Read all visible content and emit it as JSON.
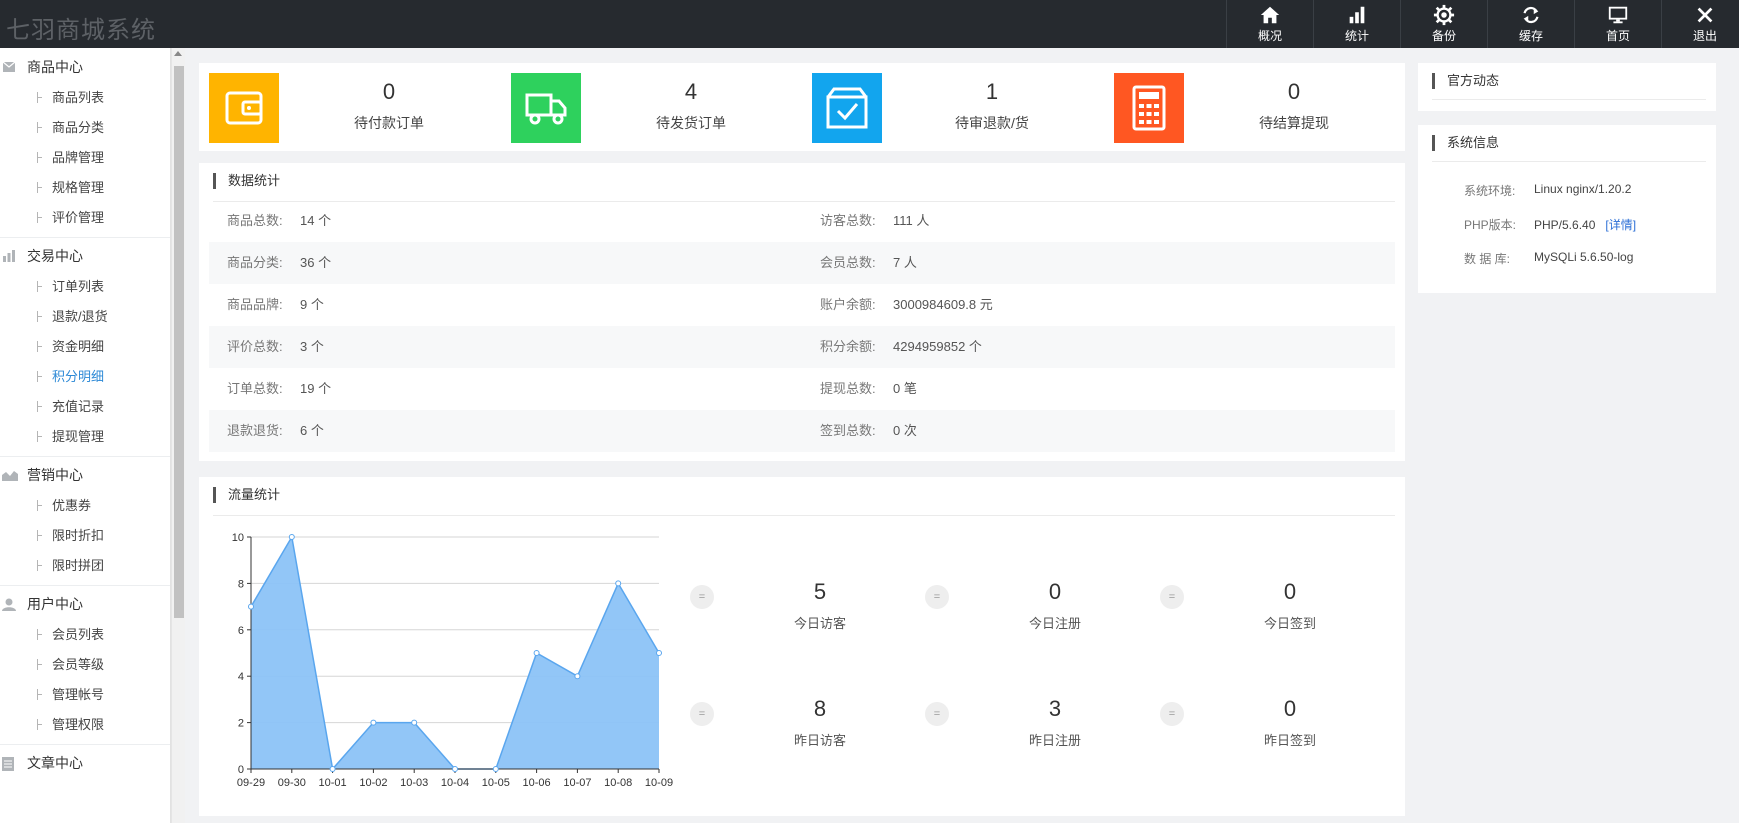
{
  "app_title": "七羽商城系统",
  "topnav": [
    {
      "label": "概况",
      "icon": "home-icon"
    },
    {
      "label": "统计",
      "icon": "bar-chart-icon"
    },
    {
      "label": "备份",
      "icon": "gear-icon"
    },
    {
      "label": "缓存",
      "icon": "refresh-icon"
    },
    {
      "label": "首页",
      "icon": "monitor-icon"
    },
    {
      "label": "退出",
      "icon": "close-icon"
    }
  ],
  "sidebar": {
    "groups": [
      {
        "label": "商品中心",
        "icon": "mail-icon",
        "items": [
          "商品列表",
          "商品分类",
          "品牌管理",
          "规格管理",
          "评价管理"
        ]
      },
      {
        "label": "交易中心",
        "icon": "bar-chart-icon",
        "items": [
          "订单列表",
          "退款/退货",
          "资金明细",
          "积分明细",
          "充值记录",
          "提现管理"
        ]
      },
      {
        "label": "营销中心",
        "icon": "area-chart-icon",
        "items": [
          "优惠券",
          "限时折扣",
          "限时拼团"
        ]
      },
      {
        "label": "用户中心",
        "icon": "user-icon",
        "items": [
          "会员列表",
          "会员等级",
          "管理帐号",
          "管理权限"
        ]
      },
      {
        "label": "文章中心",
        "icon": "document-icon",
        "items": []
      }
    ],
    "active_item": "积分明细"
  },
  "cards": [
    {
      "value": "0",
      "label": "待付款订单",
      "color": "#ffb400",
      "icon": "wallet-icon"
    },
    {
      "value": "4",
      "label": "待发货订单",
      "color": "#2ed15d",
      "icon": "truck-icon"
    },
    {
      "value": "1",
      "label": "待审退款/货",
      "color": "#12a5ee",
      "icon": "box-check-icon"
    },
    {
      "value": "0",
      "label": "待结算提现",
      "color": "#ff5722",
      "icon": "calculator-icon"
    }
  ],
  "stats": {
    "title": "数据统计",
    "rows": [
      [
        {
          "k": "商品总数:",
          "v": "14 个"
        },
        {
          "k": "访客总数:",
          "v": "111 人"
        }
      ],
      [
        {
          "k": "商品分类:",
          "v": "36 个"
        },
        {
          "k": "会员总数:",
          "v": "7 人"
        }
      ],
      [
        {
          "k": "商品品牌:",
          "v": "9 个"
        },
        {
          "k": "账户余额:",
          "v": "3000984609.8 元"
        }
      ],
      [
        {
          "k": "评价总数:",
          "v": "3 个"
        },
        {
          "k": "积分余额:",
          "v": "4294959852 个"
        }
      ],
      [
        {
          "k": "订单总数:",
          "v": "19 个"
        },
        {
          "k": "提现总数:",
          "v": "0 笔"
        }
      ],
      [
        {
          "k": "退款退货:",
          "v": "6 个"
        },
        {
          "k": "签到总数:",
          "v": "0 次"
        }
      ]
    ]
  },
  "traffic": {
    "title": "流量统计",
    "metrics": [
      {
        "value": "5",
        "label": "今日访客"
      },
      {
        "value": "0",
        "label": "今日注册"
      },
      {
        "value": "0",
        "label": "今日签到"
      },
      {
        "value": "8",
        "label": "昨日访客"
      },
      {
        "value": "3",
        "label": "昨日注册"
      },
      {
        "value": "0",
        "label": "昨日签到"
      }
    ],
    "eq_symbol": "="
  },
  "chart_data": {
    "type": "area",
    "categories": [
      "09-29",
      "09-30",
      "10-01",
      "10-02",
      "10-03",
      "10-04",
      "10-05",
      "10-06",
      "10-07",
      "10-08",
      "10-09"
    ],
    "values": [
      7,
      10,
      0,
      2,
      2,
      0,
      0,
      5,
      4,
      8,
      5
    ],
    "ylim": [
      0,
      10
    ],
    "yticks": [
      0,
      2,
      4,
      6,
      8,
      10
    ],
    "grid": true,
    "fill_color": "#8cc3f7",
    "line_color": "#5aa6ee"
  },
  "official": {
    "title": "官方动态"
  },
  "sysinfo": {
    "title": "系统信息",
    "rows": [
      {
        "k": "系统环境:",
        "v": "Linux nginx/1.20.2"
      },
      {
        "k": "PHP版本:",
        "v": "PHP/5.6.40",
        "link": "[详情]"
      },
      {
        "k": "数 据 库:",
        "v": "MySQLi 5.6.50-log"
      }
    ]
  }
}
